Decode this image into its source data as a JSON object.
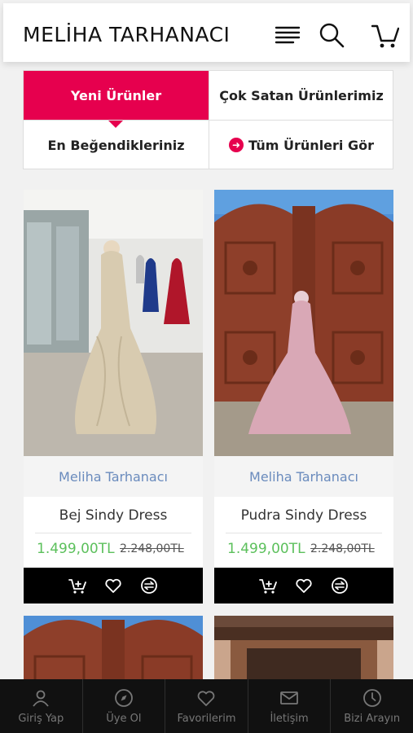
{
  "header": {
    "logo": "MELİHA TARHANACI",
    "icons": [
      "menu-icon",
      "search-icon",
      "cart-icon"
    ]
  },
  "tabs": {
    "new_products": "Yeni Ürünler",
    "best_sellers": "Çok Satan Ürünlerimiz",
    "most_liked": "En Beğendikleriniz",
    "see_all": "Tüm Ürünleri Gör"
  },
  "products": [
    {
      "brand": "Meliha Tarhanacı",
      "name": "Bej Sindy Dress",
      "price": "1.499,00TL",
      "old_price": "2.248,00TL",
      "color": "#d8cbb0"
    },
    {
      "brand": "Meliha Tarhanacı",
      "name": "Pudra Sindy Dress",
      "price": "1.499,00TL",
      "old_price": "2.248,00TL",
      "color": "#d9a8b6"
    }
  ],
  "bottom_nav": [
    {
      "label": "Giriş Yap",
      "icon": "user-icon"
    },
    {
      "label": "Üye Ol",
      "icon": "compass-icon"
    },
    {
      "label": "Favorilerim",
      "icon": "heart-icon"
    },
    {
      "label": "İletişim",
      "icon": "mail-icon"
    },
    {
      "label": "Bizi Arayın",
      "icon": "clock-icon"
    }
  ],
  "colors": {
    "accent": "#e6004e",
    "price": "#5cc05c",
    "brand": "#6a8bbd"
  }
}
